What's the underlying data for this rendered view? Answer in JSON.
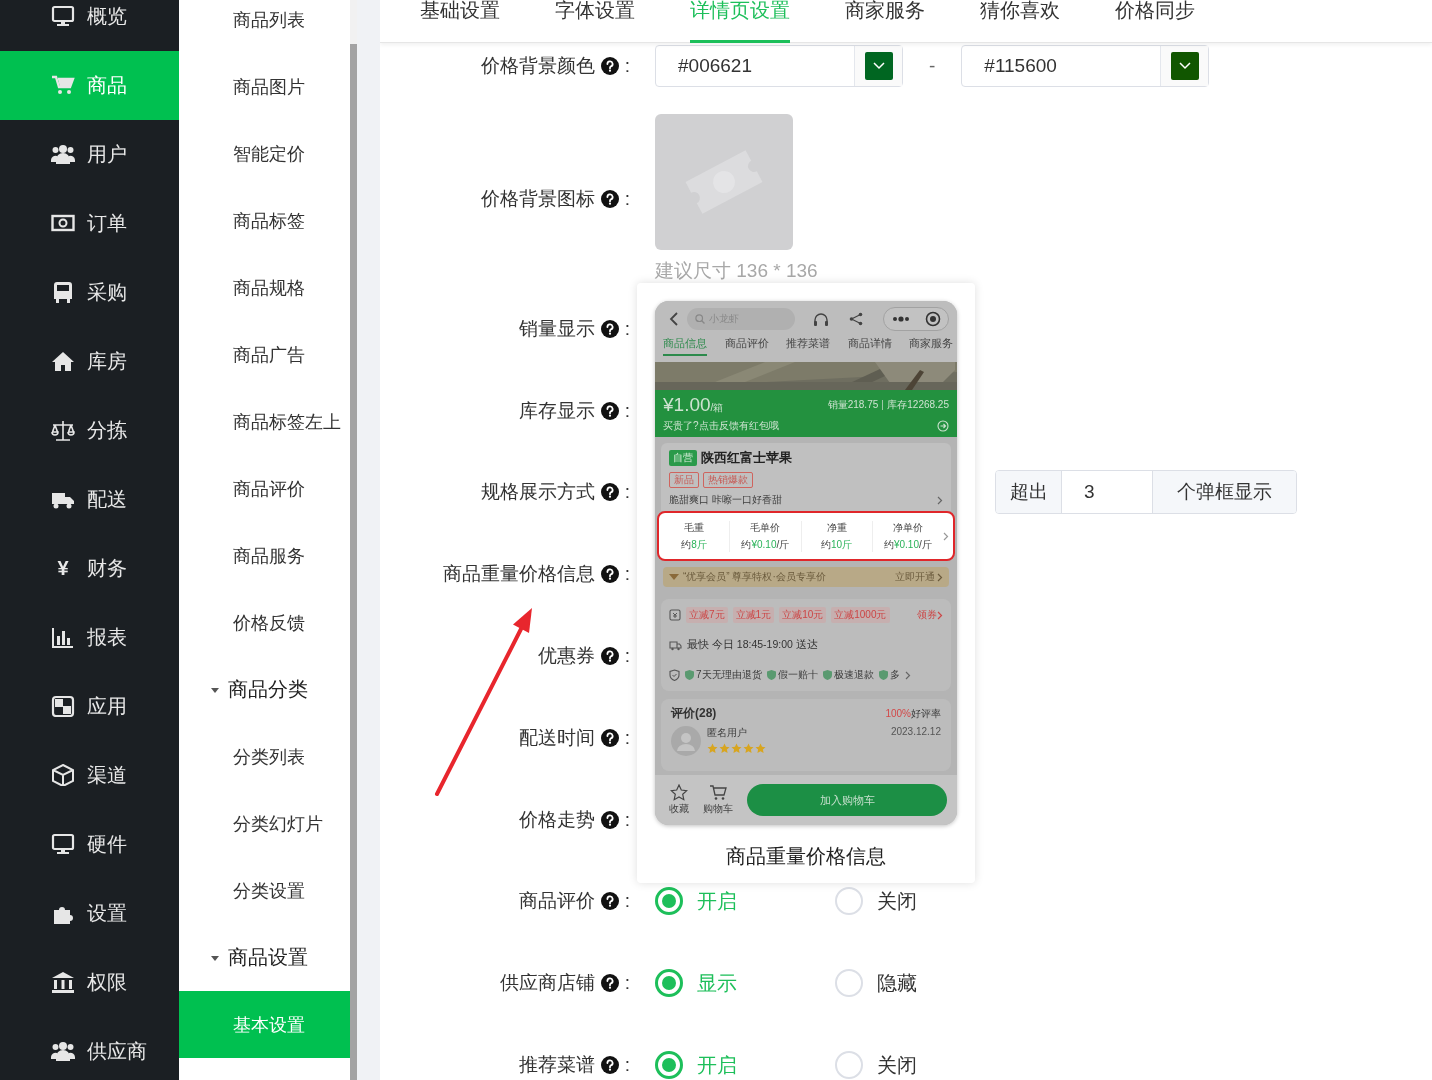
{
  "sidebar": {
    "items": [
      {
        "label": "概览",
        "selected": false
      },
      {
        "label": "商品",
        "selected": true
      },
      {
        "label": "用户",
        "selected": false
      },
      {
        "label": "订单",
        "selected": false
      },
      {
        "label": "采购",
        "selected": false
      },
      {
        "label": "库房",
        "selected": false
      },
      {
        "label": "分拣",
        "selected": false
      },
      {
        "label": "配送",
        "selected": false
      },
      {
        "label": "财务",
        "selected": false,
        "glyph": "¥"
      },
      {
        "label": "报表",
        "selected": false
      },
      {
        "label": "应用",
        "selected": false
      },
      {
        "label": "渠道",
        "selected": false
      },
      {
        "label": "硬件",
        "selected": false
      },
      {
        "label": "设置",
        "selected": false
      },
      {
        "label": "权限",
        "selected": false
      },
      {
        "label": "供应商",
        "selected": false
      }
    ]
  },
  "submenu": {
    "items": [
      {
        "label": "商品列表",
        "selected": false
      },
      {
        "label": "商品图片",
        "selected": false
      },
      {
        "label": "智能定价",
        "selected": false
      },
      {
        "label": "商品标签",
        "selected": false
      },
      {
        "label": "商品规格",
        "selected": false
      },
      {
        "label": "商品广告",
        "selected": false
      },
      {
        "label": "商品标签左上",
        "selected": false
      },
      {
        "label": "商品评价",
        "selected": false
      },
      {
        "label": "商品服务",
        "selected": false
      },
      {
        "label": "价格反馈",
        "selected": false
      },
      {
        "label": "商品分类",
        "expanded": true,
        "children": [
          {
            "label": "分类列表",
            "selected": false
          },
          {
            "label": "分类幻灯片",
            "selected": false
          },
          {
            "label": "分类设置",
            "selected": false
          }
        ]
      },
      {
        "label": "商品设置",
        "expanded": true,
        "children": [
          {
            "label": "基本设置",
            "selected": true
          }
        ]
      }
    ]
  },
  "tabs": [
    {
      "label": "基础设置",
      "selected": false
    },
    {
      "label": "字体设置",
      "selected": false
    },
    {
      "label": "详情页设置",
      "selected": true
    },
    {
      "label": "商家服务",
      "selected": false
    },
    {
      "label": "猜你喜欢",
      "selected": false
    },
    {
      "label": "价格同步",
      "selected": false
    }
  ],
  "form": {
    "rows": [
      {
        "kind": "color_range",
        "label": "价格背景颜色",
        "colon": ":",
        "from": {
          "value": "#006621",
          "color": "#006621"
        },
        "separator": "-",
        "to": {
          "value": "#115600",
          "color": "#115600"
        }
      },
      {
        "kind": "image_upload",
        "label": "价格背景图标",
        "colon": ":",
        "hint": "建议尺寸 136 * 136"
      },
      {
        "kind": "covered",
        "label": "销量显示",
        "colon": ":"
      },
      {
        "kind": "covered",
        "label": "库存显示",
        "colon": ":"
      },
      {
        "kind": "input_group",
        "label": "规格展示方式",
        "colon": ":",
        "prefix": "超出",
        "value": "3",
        "suffix": "个弹框显示"
      },
      {
        "kind": "covered",
        "label": "商品重量价格信息",
        "colon": ":"
      },
      {
        "kind": "covered",
        "label": "优惠券",
        "colon": ":"
      },
      {
        "kind": "covered",
        "label": "配送时间",
        "colon": ":"
      },
      {
        "kind": "covered",
        "label": "价格走势",
        "colon": ":"
      },
      {
        "kind": "radio",
        "label": "商品评价",
        "colon": ":",
        "options": [
          {
            "label": "开启",
            "selected": true
          },
          {
            "label": "关闭",
            "selected": false
          }
        ]
      },
      {
        "kind": "radio",
        "label": "供应商店铺",
        "colon": ":",
        "options": [
          {
            "label": "显示",
            "selected": true
          },
          {
            "label": "隐藏",
            "selected": false
          }
        ]
      },
      {
        "kind": "radio",
        "label": "推荐菜谱",
        "colon": ":",
        "options": [
          {
            "label": "开启",
            "selected": true
          },
          {
            "label": "关闭",
            "selected": false
          }
        ]
      }
    ]
  },
  "preview": {
    "caption": "商品重量价格信息",
    "phone": {
      "search_placeholder": "小龙虾",
      "tabs": [
        {
          "label": "商品信息",
          "selected": true
        },
        {
          "label": "商品评价",
          "selected": false
        },
        {
          "label": "推荐菜谱",
          "selected": false
        },
        {
          "label": "商品详情",
          "selected": false
        },
        {
          "label": "商家服务",
          "selected": false
        }
      ],
      "price": "¥1.00",
      "unit": "/箱",
      "sales": "销量218.75",
      "stock": "库存12268.25",
      "feedback": "买贵了?点击反馈有红包哦",
      "product": {
        "badge": "自营",
        "name": "陕西红富士苹果",
        "tags": [
          "新品",
          "热销爆款"
        ],
        "description": "脆甜爽口 咔嚓一口好香甜"
      },
      "specs": [
        {
          "label": "毛重",
          "prefix": "约",
          "value": "8斤"
        },
        {
          "label": "毛单价",
          "prefix": "约",
          "value": "¥0.10",
          "suffix": "/斤"
        },
        {
          "label": "净重",
          "prefix": "约",
          "value": "10斤"
        },
        {
          "label": "净单价",
          "prefix": "约",
          "value": "¥0.10",
          "suffix": "/斤"
        }
      ],
      "member": {
        "text": "“优享会员” 尊享特权·会员专享价",
        "action": "立即开通"
      },
      "coupons": [
        "立减7元",
        "立减1元",
        "立减10元",
        "立减1000元"
      ],
      "coupon_action": "领券",
      "delivery": "最快 今日 18:45-19:00 送达",
      "guarantees": [
        "7天无理由退货",
        "假一赔十",
        "极速退款",
        "多"
      ],
      "review": {
        "title": "评价(28)",
        "rate": "100%",
        "rate_label": "好评率",
        "user": "匿名用户",
        "date": "2023.12.12",
        "stars": 5
      },
      "bottom": {
        "favorite": "收藏",
        "cart": "购物车",
        "button": "加入购物车"
      }
    }
  }
}
